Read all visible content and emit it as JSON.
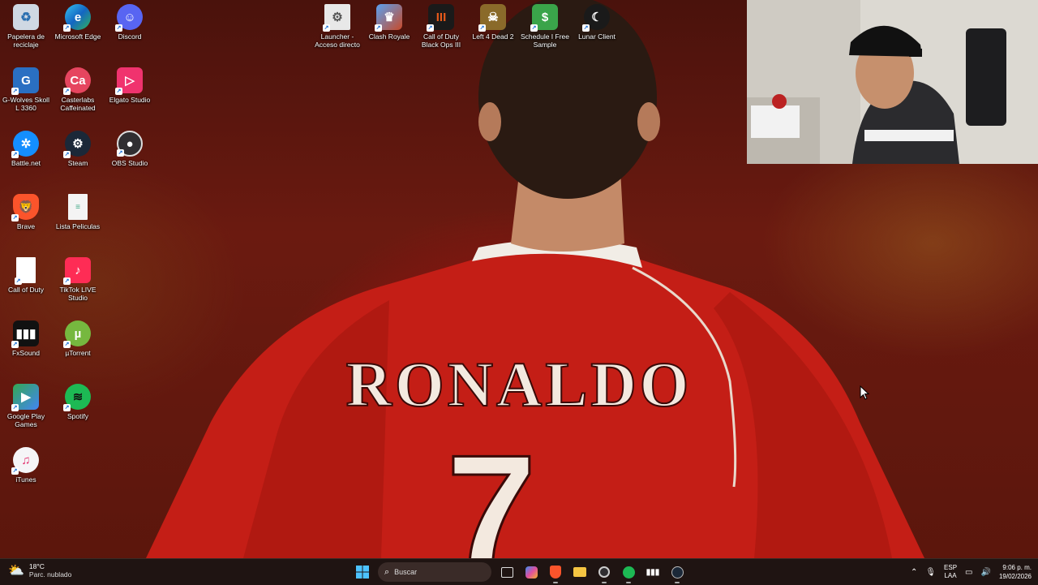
{
  "desktop_left": [
    {
      "label": "Papelera de reciclaje",
      "icon": "recycle-bin-icon",
      "color": "#cfd8e3"
    },
    {
      "label": "Microsoft Edge",
      "icon": "edge-icon",
      "color": "#1c8fd6"
    },
    {
      "label": "Discord",
      "icon": "discord-icon",
      "color": "#5865f2"
    },
    {
      "label": "G-Wolves Skoll L 3360",
      "icon": "gwolves-icon",
      "color": "#2a6fc2"
    },
    {
      "label": "Casterlabs Caffeinated",
      "icon": "casterlabs-icon",
      "color": "#e6455f"
    },
    {
      "label": "Elgato Studio",
      "icon": "elgato-icon",
      "color": "#f0336e"
    },
    {
      "label": "Battle.net",
      "icon": "battlenet-icon",
      "color": "#148eff"
    },
    {
      "label": "Steam",
      "icon": "steam-icon",
      "color": "#1b2838"
    },
    {
      "label": "OBS Studio",
      "icon": "obs-icon",
      "color": "#302e31"
    },
    {
      "label": "Brave",
      "icon": "brave-icon",
      "color": "#fb542b"
    },
    {
      "label": "Lista Peliculas",
      "icon": "document-icon",
      "color": "#f4f4f4"
    },
    {
      "label": "Call of Duty",
      "icon": "blank-file-icon",
      "color": "#ffffff"
    },
    {
      "label": "TikTok LIVE Studio",
      "icon": "tiktok-icon",
      "color": "#fe2c55"
    },
    {
      "label": "FxSound",
      "icon": "fxsound-icon",
      "color": "#111111"
    },
    {
      "label": "µTorrent",
      "icon": "utorrent-icon",
      "color": "#76b83f"
    },
    {
      "label": "Google Play Games",
      "icon": "google-play-games-icon",
      "color": "#2e8b57"
    },
    {
      "label": "Spotify",
      "icon": "spotify-icon",
      "color": "#1db954"
    },
    {
      "label": "iTunes",
      "icon": "itunes-icon",
      "color": "#f5f5f7"
    }
  ],
  "desktop_top": [
    {
      "label": "Launcher - Acceso directo",
      "icon": "launcher-icon",
      "color": "#e8e8e8"
    },
    {
      "label": "Clash Royale",
      "icon": "clash-royale-icon",
      "color": "#3d7bd6"
    },
    {
      "label": "Call of Duty Black Ops III",
      "icon": "black-ops-icon",
      "color": "#1a1a1a"
    },
    {
      "label": "Left 4 Dead 2",
      "icon": "left4dead-icon",
      "color": "#8a6a2a"
    },
    {
      "label": "Schedule I Free Sample",
      "icon": "schedule-icon",
      "color": "#3aa44a"
    },
    {
      "label": "Lunar Client",
      "icon": "lunar-client-icon",
      "color": "#1a1a1a"
    }
  ],
  "wallpaper": {
    "name_text": "RONALDO",
    "number_text": "7"
  },
  "taskbar": {
    "weather": {
      "temp": "18°C",
      "desc": "Parc. nublado"
    },
    "search_placeholder": "Buscar",
    "lang_top": "ESP",
    "lang_bottom": "LAA",
    "time": "9:06 p. m.",
    "date": "19/02/2026"
  }
}
